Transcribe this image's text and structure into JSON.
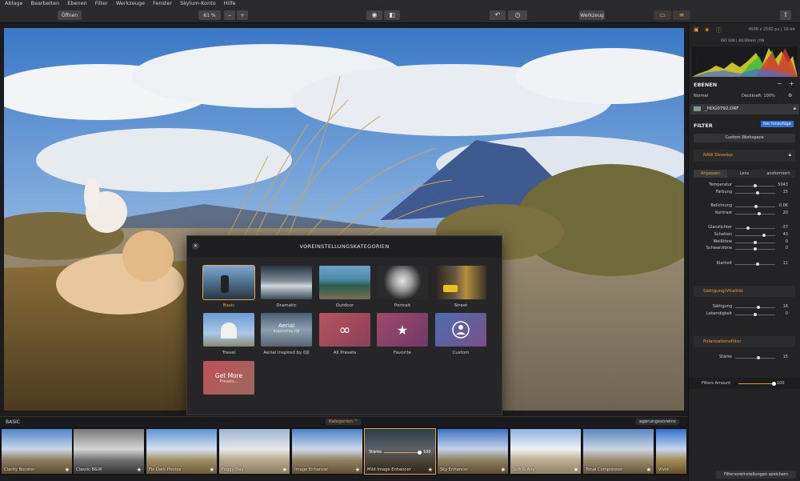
{
  "menu": [
    "Ablage",
    "Bearbeiten",
    "Ebenen",
    "Filter",
    "Werkzeuge",
    "Fenster",
    "Skylum-Konto",
    "Hilfe"
  ],
  "toolbar": {
    "open": "Öffnen",
    "zoom": "61 %",
    "zoom_minus": "−",
    "zoom_plus": "+",
    "tools": "Werkzeug"
  },
  "dialog": {
    "title": "VOREINSTELLUNGSKATEGORIEN",
    "close": "✕",
    "categories": [
      {
        "label": "Basic"
      },
      {
        "label": "Dramatic"
      },
      {
        "label": "Outdoor"
      },
      {
        "label": "Portrait"
      },
      {
        "label": "Street"
      },
      {
        "label": "Travel"
      },
      {
        "label": "Aerial Inspired by DJI",
        "thumb_text": "Aerial",
        "thumb_sub": "Inspired by DJI"
      },
      {
        "label": "All Presets",
        "glyph": "∞"
      },
      {
        "label": "Favorite",
        "glyph": "★"
      },
      {
        "label": "Custom"
      }
    ],
    "get_more": "Get More",
    "get_more_sub": "Presets..."
  },
  "bottom": {
    "left": "BASIC",
    "kategorien": "Kategorien ^",
    "right": "agerungsvoreins"
  },
  "presets": [
    {
      "name": "Clarity Booster"
    },
    {
      "name": "Classic B&W"
    },
    {
      "name": "Fix Dark Photos"
    },
    {
      "name": "Foggy Day"
    },
    {
      "name": "Image Enhancer"
    },
    {
      "name": "Mild Image Enhancer",
      "slider": "Stärke",
      "value": "100"
    },
    {
      "name": "Sky Enhancer"
    },
    {
      "name": "Soft & Airy"
    },
    {
      "name": "Tonal Compressor"
    },
    {
      "name": "Vivid"
    }
  ],
  "sidebar": {
    "image_info": "4608 x 2592 px | 16-bit",
    "camera_info": "ISO 100 | 40.00mm | f/8",
    "layers_title": "EBENEN",
    "blend": "Normal",
    "opacity": "Deckkraft: 100%",
    "layer_name": "_HDG0792.ORF",
    "filter_title": "FILTER",
    "filter_add": "lter hinzufüge",
    "workspace": "Custom Workspace",
    "raw_title": "RAW Develop",
    "tabs": [
      "Anpassen",
      "Lens",
      "ansformiert"
    ],
    "sliders1": [
      {
        "n": "Temperatur",
        "v": "5043",
        "p": 0.5
      },
      {
        "n": "Färbung",
        "v": "15",
        "p": 0.55
      }
    ],
    "sliders2": [
      {
        "n": "Belichtung",
        "v": "0.06",
        "p": 0.51
      },
      {
        "n": "Kontrast",
        "v": "20",
        "p": 0.6
      }
    ],
    "sliders3": [
      {
        "n": "Glanzlichter",
        "v": "-37",
        "p": 0.31
      },
      {
        "n": "Schatten",
        "v": "43",
        "p": 0.71
      },
      {
        "n": "Weißtöne",
        "v": "0",
        "p": 0.5
      },
      {
        "n": "Schwarztöne",
        "v": "0",
        "p": 0.5
      }
    ],
    "sliders4": [
      {
        "n": "Klarheit",
        "v": "11",
        "p": 0.55
      }
    ],
    "sat_title": "Sättigung/Vitalität",
    "sliders5": [
      {
        "n": "Sättigung",
        "v": "16",
        "p": 0.58
      },
      {
        "n": "Lebendigkeit",
        "v": "0",
        "p": 0.5
      }
    ],
    "pol_title": "Polarisationsfilter",
    "sliders6": [
      {
        "n": "Stärke",
        "v": "15",
        "p": 0.57
      }
    ],
    "amount_label": "Filters Amount",
    "amount_value": "100",
    "save_btn": "Filtervoreinstellungen speichern"
  }
}
